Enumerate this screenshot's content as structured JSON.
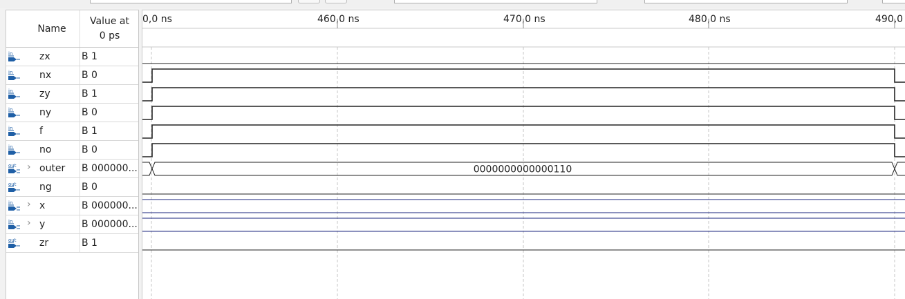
{
  "header": {
    "name_label": "Name",
    "value_label_line1": "Value at",
    "value_label_line2": "0 ps"
  },
  "timeline": {
    "ticks": [
      {
        "label": "0,0 ns"
      },
      {
        "label": "460,0 ns"
      },
      {
        "label": "470,0 ns"
      },
      {
        "label": "480,0 ns"
      },
      {
        "label": "490,0"
      }
    ]
  },
  "signals": [
    {
      "name": "zx",
      "value": "B 1",
      "dir": "in",
      "bus": false
    },
    {
      "name": "nx",
      "value": "B 0",
      "dir": "in",
      "bus": false
    },
    {
      "name": "zy",
      "value": "B 1",
      "dir": "in",
      "bus": false
    },
    {
      "name": "ny",
      "value": "B 0",
      "dir": "in",
      "bus": false
    },
    {
      "name": "f",
      "value": "B 1",
      "dir": "in",
      "bus": false
    },
    {
      "name": "no",
      "value": "B 0",
      "dir": "in",
      "bus": false
    },
    {
      "name": "outer",
      "value": "B 000000...",
      "dir": "out",
      "bus": true,
      "wave_value": "0000000000000110"
    },
    {
      "name": "ng",
      "value": "B 0",
      "dir": "out",
      "bus": false
    },
    {
      "name": "x",
      "value": "B 000000...",
      "dir": "in",
      "bus": true
    },
    {
      "name": "y",
      "value": "B 000000...",
      "dir": "in",
      "bus": true
    },
    {
      "name": "zr",
      "value": "B 1",
      "dir": "out",
      "bus": false
    }
  ],
  "colors": {
    "in_icon": "#1f5fa6",
    "out_icon": "#1f5fa6",
    "bus_wave": "#1a237e",
    "grid": "#c6c6c6"
  },
  "icons": {
    "input": "input-pin-icon",
    "output": "output-pin-icon",
    "expand": "chevron-right-icon"
  }
}
